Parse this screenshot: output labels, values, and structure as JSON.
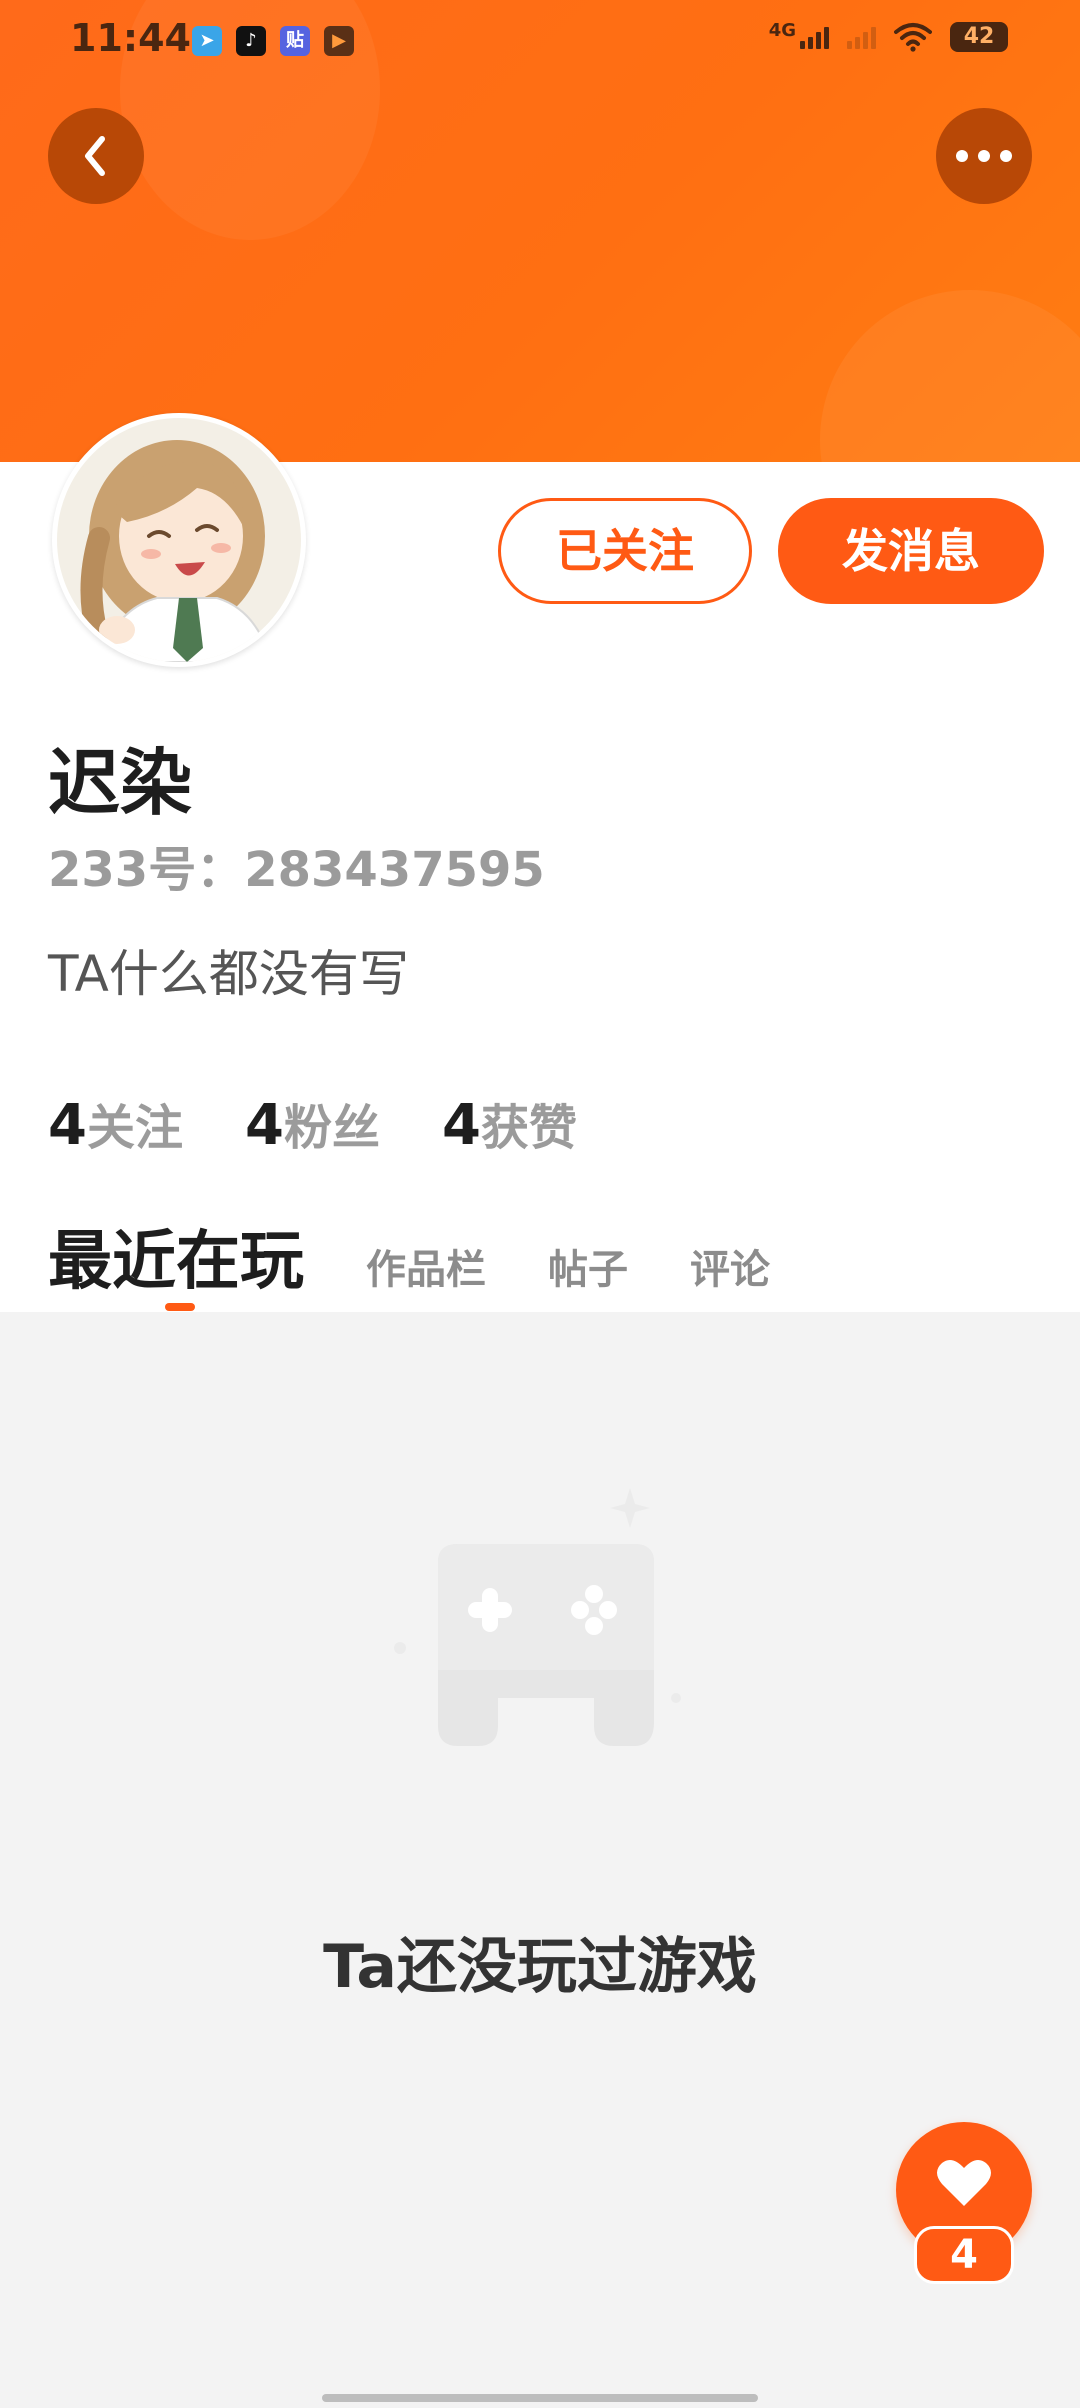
{
  "status_bar": {
    "time": "11:44",
    "apps": [
      {
        "icon": "telegram-icon",
        "glyph": "➤"
      },
      {
        "icon": "tiktok-icon",
        "glyph": "♪"
      },
      {
        "icon": "tieba-icon",
        "glyph": "贴"
      },
      {
        "icon": "video-play-icon",
        "glyph": "▶"
      }
    ],
    "network": "4G",
    "battery": "42"
  },
  "header": {
    "back_icon": "chevron-left-icon",
    "more_icon": "more-horizontal-icon",
    "banner_color": "#ff6a1a"
  },
  "profile": {
    "nickname": "迟染",
    "uid": "233号：283437595",
    "bio": "TA什么都没有写",
    "follow_button": "已关注",
    "message_button": "发消息",
    "stats": [
      {
        "num": "4",
        "label": "关注"
      },
      {
        "num": "4",
        "label": "粉丝"
      },
      {
        "num": "4",
        "label": "获赞"
      }
    ]
  },
  "tabs": [
    {
      "label": "最近在玩",
      "active": true
    },
    {
      "label": "作品栏",
      "active": false
    },
    {
      "label": "帖子",
      "active": false
    },
    {
      "label": "评论",
      "active": false
    }
  ],
  "empty_state": {
    "icon": "gamepad-icon",
    "text": "Ta还没玩过游戏"
  },
  "like_button": {
    "icon": "heart-icon",
    "count": "4"
  },
  "colors": {
    "accent": "#ff5a14",
    "empty_bg": "#f3f3f3"
  }
}
